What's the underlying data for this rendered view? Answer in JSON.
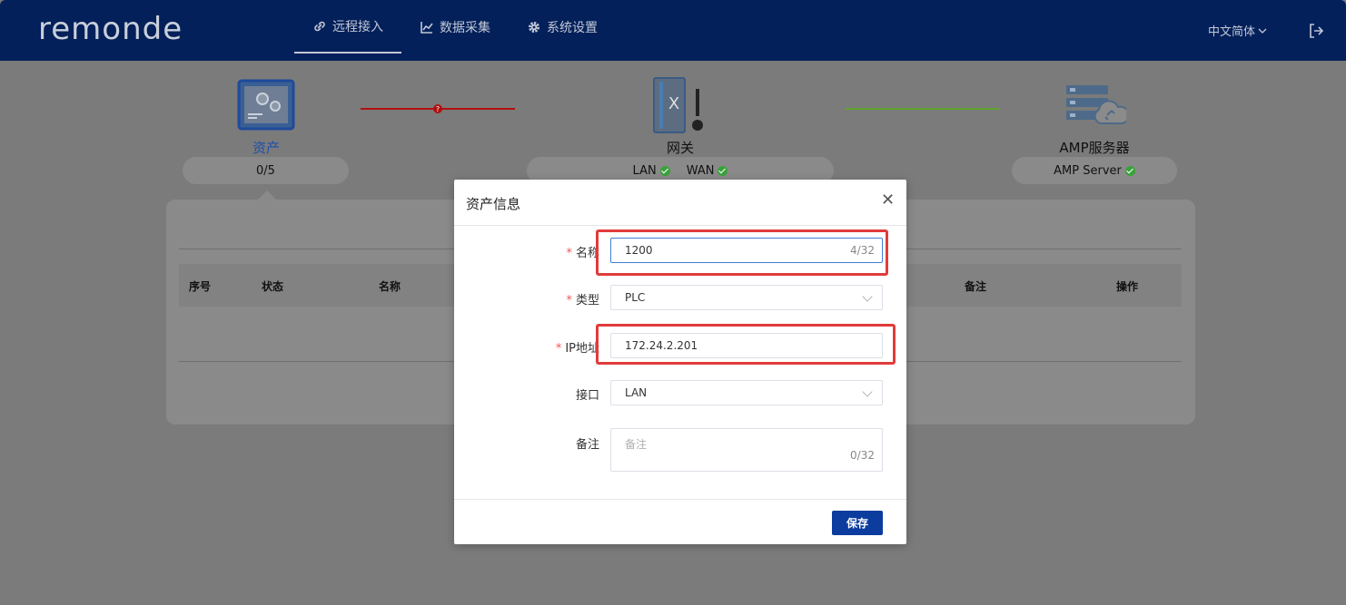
{
  "header": {
    "logo": "remonde",
    "nav": [
      {
        "label": "远程接入",
        "icon": "link-icon",
        "active": true
      },
      {
        "label": "数据采集",
        "icon": "chart-icon",
        "active": false
      },
      {
        "label": "系统设置",
        "icon": "gear-icon",
        "active": false
      }
    ],
    "language": "中文简体"
  },
  "topology": {
    "asset": {
      "label": "资产",
      "count": "0/5"
    },
    "gateway": {
      "label": "网关",
      "lan": "LAN",
      "wan": "WAN"
    },
    "amp": {
      "label": "AMP服务器",
      "status": "AMP Server"
    },
    "colors": {
      "asset_link": "#b01010",
      "amp_link": "#5ea52b",
      "active_label": "#1e4fae"
    }
  },
  "table": {
    "columns": [
      "序号",
      "状态",
      "名称",
      "备注",
      "操作"
    ]
  },
  "modal": {
    "title": "资产信息",
    "fields": {
      "name": {
        "label": "名称",
        "value": "1200",
        "counter": "4/32",
        "required": true
      },
      "type": {
        "label": "类型",
        "value": "PLC",
        "required": true
      },
      "ip": {
        "label": "IP地址",
        "value": "172.24.2.201",
        "required": true
      },
      "interface": {
        "label": "接口",
        "value": "LAN",
        "required": false
      },
      "remark": {
        "label": "备注",
        "placeholder": "备注",
        "counter": "0/32",
        "required": false
      }
    },
    "save_label": "保存"
  }
}
